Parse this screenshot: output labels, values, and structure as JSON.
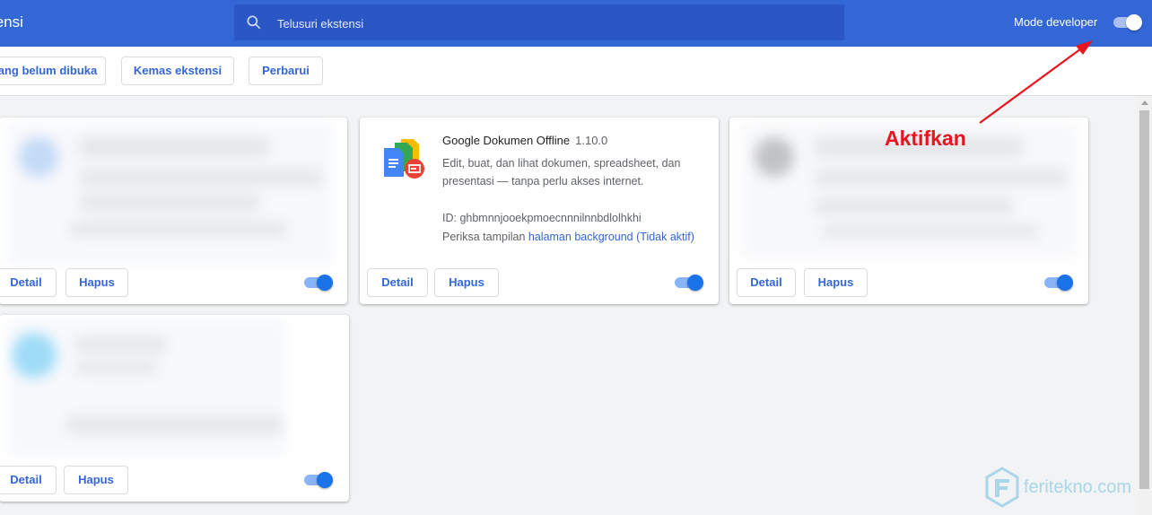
{
  "header": {
    "title": "tensi",
    "search_placeholder": "Telusuri ekstensi",
    "dev_mode_label": "Mode developer",
    "dev_mode_on": true
  },
  "toolbar": {
    "load_unpacked": "ang belum dibuka",
    "pack_extension": "Kemas ekstensi",
    "update": "Perbarui"
  },
  "extensions": [
    {
      "name": "Google Dokumen Offline",
      "version": "1.10.0",
      "description": "Edit, buat, dan lihat dokumen, spreadsheet, dan presentasi — tanpa perlu akses internet.",
      "id_label": "ID: ghbmnnjooekpmoecnnnilnnbdlolhkhi",
      "inspect_prefix": "Periksa tampilan",
      "inspect_link": "halaman background (Tidak aktif)",
      "enabled": true
    }
  ],
  "card_buttons": {
    "details": "Detail",
    "remove": "Hapus"
  },
  "annotation": {
    "text": "Aktifkan",
    "color": "#e8141f"
  },
  "watermark": {
    "text": "feritekno.com"
  },
  "colors": {
    "header": "#3367d6",
    "accent": "#1a73e8",
    "background": "#f1f3f4"
  }
}
